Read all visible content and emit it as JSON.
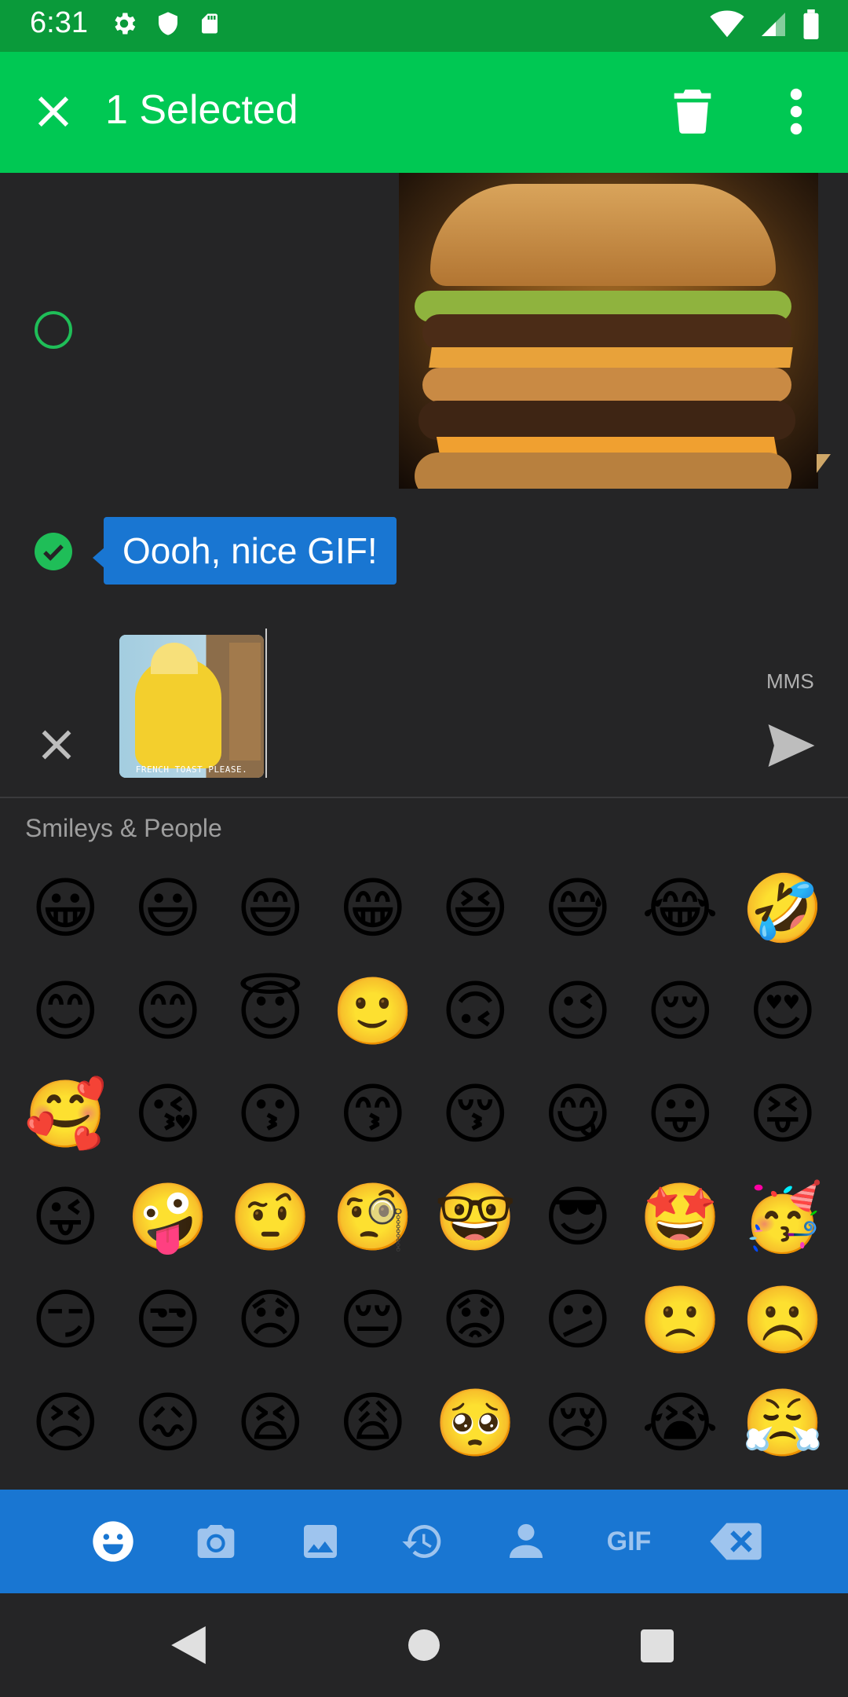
{
  "status_bar": {
    "time": "6:31",
    "left_icons": [
      "settings-icon",
      "shield-icon",
      "sd-card-icon"
    ],
    "right_icons": [
      "wifi-icon",
      "signal-icon",
      "battery-icon"
    ]
  },
  "app_bar": {
    "title": "1 Selected",
    "background_color": "#00c853"
  },
  "conversation": {
    "items": [
      {
        "type": "gif",
        "selected": false
      },
      {
        "type": "text",
        "text": "Oooh, nice GIF!",
        "selected": true,
        "bubble_color": "#1976d2"
      }
    ]
  },
  "compose": {
    "attachment_caption": "FRENCH TOAST PLEASE.",
    "mode_label": "MMS"
  },
  "emoji_panel": {
    "section_title": "Smileys & People",
    "emojis": [
      "😀",
      "😃",
      "😄",
      "😁",
      "😆",
      "😅",
      "😂",
      "🤣",
      "😊",
      "😊",
      "😇",
      "🙂",
      "🙃",
      "😉",
      "😌",
      "😍",
      "🥰",
      "😘",
      "😗",
      "😙",
      "😚",
      "😋",
      "😛",
      "😝",
      "😜",
      "🤪",
      "🤨",
      "🧐",
      "🤓",
      "😎",
      "🤩",
      "🥳",
      "😏",
      "😒",
      "😞",
      "😔",
      "😟",
      "😕",
      "🙁",
      "☹️",
      "😣",
      "😖",
      "😫",
      "😩",
      "🥺",
      "😢",
      "😭",
      "😤"
    ]
  },
  "emoji_tabs": [
    "smiley-icon",
    "camera-icon",
    "image-icon",
    "history-icon",
    "person-icon",
    "GIF",
    "backspace-icon"
  ],
  "nav_bar": [
    "back-icon",
    "home-icon",
    "recents-icon"
  ]
}
